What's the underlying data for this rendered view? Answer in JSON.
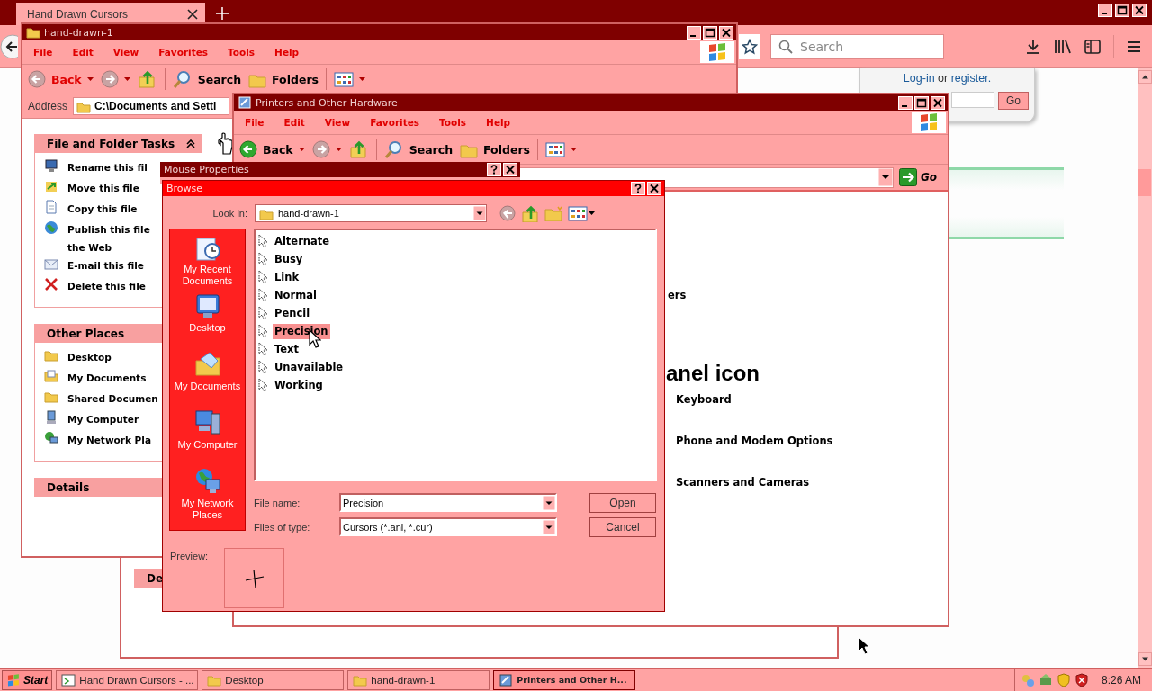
{
  "browser": {
    "tab": {
      "title": "Hand Drawn Cursors",
      "selected": true
    },
    "search": {
      "placeholder": "Search"
    },
    "login": {
      "login_link": "Log-in",
      "joiner": "or",
      "register_link": "register."
    },
    "go_button": "Go"
  },
  "background_window": {
    "panel_title": "De"
  },
  "explorer": {
    "title": "hand-drawn-1",
    "menu": [
      "File",
      "Edit",
      "View",
      "Favorites",
      "Tools",
      "Help"
    ],
    "back": {
      "label": "Back",
      "disabled": true
    },
    "forward": {
      "disabled": true
    },
    "search": "Search",
    "folders": "Folders",
    "address_label": "Address",
    "address": "C:\\Documents and Setti",
    "panels": [
      {
        "title": "File and Folder Tasks",
        "expanded": true,
        "items": [
          "Rename this fil",
          "Move this file",
          "Copy this file",
          "Publish this file\nthe Web",
          "E-mail this file",
          "Delete this file"
        ]
      },
      {
        "title": "Other Places",
        "items": [
          "Desktop",
          "My Documents",
          "Shared Documen",
          "My Computer",
          "My Network Pla"
        ]
      },
      {
        "title": "Details"
      }
    ]
  },
  "printers": {
    "title": "Printers and Other Hardware",
    "menu": [
      "File",
      "Edit",
      "View",
      "Favorites",
      "Tools",
      "Help"
    ],
    "back": {
      "label": "Back",
      "disabled": false
    },
    "forward": {
      "disabled": true
    },
    "search": "Search",
    "folders": "Folders",
    "go": "Go",
    "heading_fragment": "ers",
    "title_fragment": "anel icon",
    "tasks": [
      "Keyboard",
      "Phone and Modem Options",
      "Scanners and Cameras"
    ]
  },
  "mouse_properties": {
    "title": "Mouse Properties"
  },
  "browse": {
    "title": "Browse",
    "look_in_label": "Look in:",
    "look_in": "hand-drawn-1",
    "places": [
      "My Recent Documents",
      "Desktop",
      "My Documents",
      "My Computer",
      "My Network Places"
    ],
    "files": [
      {
        "name": "Alternate",
        "selected": false
      },
      {
        "name": "Busy",
        "selected": false
      },
      {
        "name": "Link",
        "selected": false
      },
      {
        "name": "Normal",
        "selected": false
      },
      {
        "name": "Pencil",
        "selected": false
      },
      {
        "name": "Precision",
        "selected": true
      },
      {
        "name": "Text",
        "selected": false
      },
      {
        "name": "Unavailable",
        "selected": false
      },
      {
        "name": "Working",
        "selected": false
      }
    ],
    "file_name_label": "File name:",
    "file_name": "Precision",
    "file_type_label": "Files of type:",
    "file_type": "Cursors (*.ani, *.cur)",
    "open": "Open",
    "cancel": "Cancel",
    "preview_label": "Preview:"
  },
  "taskbar": {
    "start": "Start",
    "tasks": [
      {
        "label": "Hand Drawn Cursors - ...",
        "selected": false
      },
      {
        "label": "Desktop",
        "selected": false
      },
      {
        "label": "hand-drawn-1",
        "selected": false
      },
      {
        "label": "Printers and Other H...",
        "selected": true
      }
    ],
    "clock": "8:26 AM"
  }
}
